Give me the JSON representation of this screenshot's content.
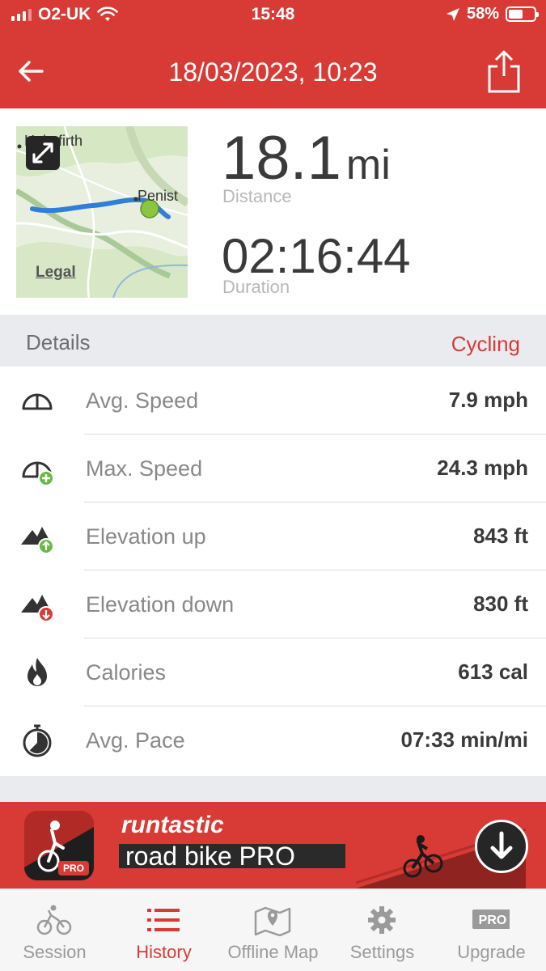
{
  "status_bar": {
    "carrier": "O2-UK",
    "time": "15:48",
    "battery": "58%",
    "battery_level": 0.58
  },
  "header": {
    "title": "18/03/2023, 10:23"
  },
  "map": {
    "place_1": "Holmfirth",
    "place_2": "Penist",
    "legal": "Legal"
  },
  "summary": {
    "distance_value": "18.1",
    "distance_unit": "mi",
    "distance_label": "Distance",
    "duration_value": "02:16:44",
    "duration_label": "Duration"
  },
  "details": {
    "title": "Details",
    "activity": "Cycling",
    "rows": [
      {
        "label": "Avg. Speed",
        "value": "7.9 mph",
        "icon": "speedometer-icon"
      },
      {
        "label": "Max. Speed",
        "value": "24.3 mph",
        "icon": "speedometer-plus-icon"
      },
      {
        "label": "Elevation up",
        "value": "843 ft",
        "icon": "elevation-up-icon"
      },
      {
        "label": "Elevation down",
        "value": "830 ft",
        "icon": "elevation-down-icon"
      },
      {
        "label": "Calories",
        "value": "613 cal",
        "icon": "flame-icon"
      },
      {
        "label": "Avg. Pace",
        "value": "07:33 min/mi",
        "icon": "stopwatch-icon"
      }
    ]
  },
  "banner": {
    "brand": "runtastic",
    "product": "road bike PRO",
    "icon_tag": "PRO"
  },
  "tabs": [
    {
      "label": "Session",
      "icon": "cyclist-icon",
      "active": false
    },
    {
      "label": "History",
      "icon": "list-icon",
      "active": true
    },
    {
      "label": "Offline Map",
      "icon": "offline-map-icon",
      "active": false
    },
    {
      "label": "Settings",
      "icon": "gear-icon",
      "active": false
    },
    {
      "label": "Upgrade",
      "icon": "pro-badge-icon",
      "active": false,
      "badge": "PRO"
    }
  ],
  "colors": {
    "brand_red": "#d83a36",
    "route_blue": "#2f7fd8",
    "start_green": "#8cc63f"
  }
}
